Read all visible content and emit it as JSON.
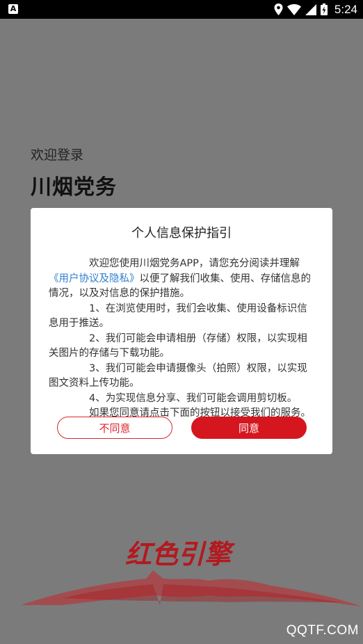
{
  "status_bar": {
    "app_icon_letter": "A",
    "time": "5:24"
  },
  "screen": {
    "welcome": "欢迎登录",
    "app_title": "川烟党务"
  },
  "dialog": {
    "title": "个人信息保护指引",
    "intro_before_link": "欢迎您使用川烟党务APP，请您充分阅读并理解",
    "link_text": "《用户协议及隐私》",
    "intro_after_link": "以便了解我们收集、使用、存储信息的情况，以及对信息的保护措施。",
    "items": [
      "1、在浏览使用时，我们会收集、使用设备标识信息用于推送。",
      "2、我们可能会申请相册（存储）权限，以实现相关图片的存储与下载功能。",
      "3、我们可能会申请摄像头（拍照）权限，以实现图文资料上传功能。",
      "4、为实现信息分享、我们可能会调用剪切板。"
    ],
    "closing": "如果您同意请点击下面的按钮以接受我们的服务。",
    "disagree_label": "不同意",
    "agree_label": "同意"
  },
  "logo": {
    "text": "红色引擎"
  },
  "watermark": "QQTF.COM",
  "colors": {
    "accent": "#d6161f",
    "link": "#2f7fcf",
    "overlay": "#7b7b7b"
  }
}
